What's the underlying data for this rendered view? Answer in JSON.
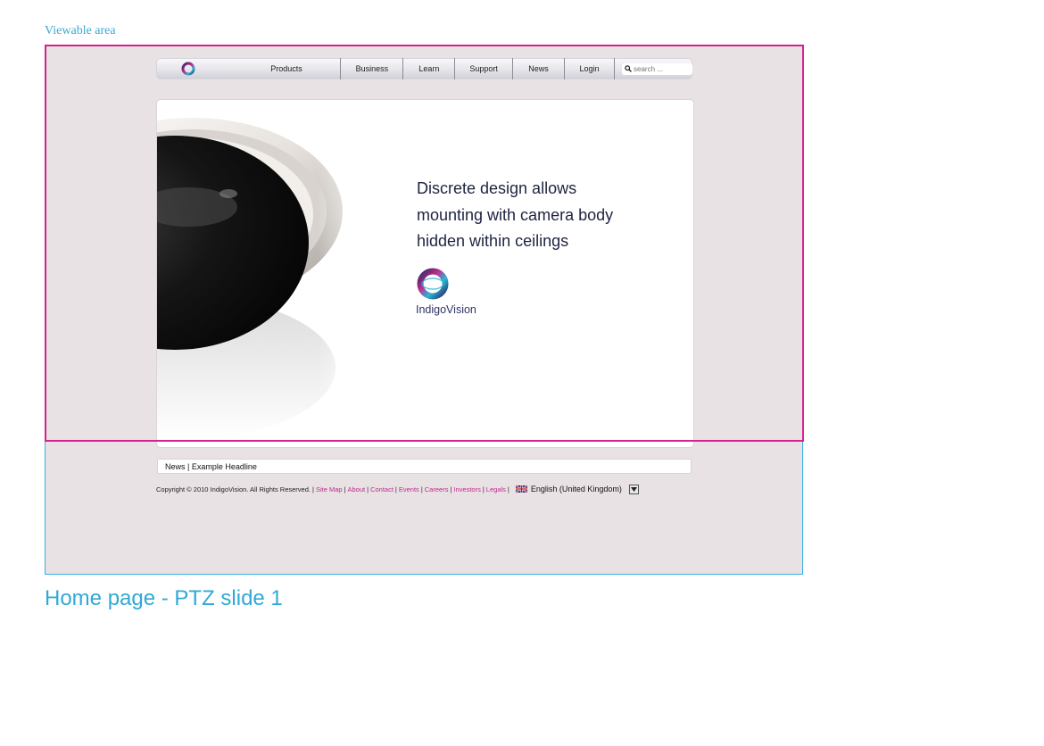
{
  "annotation": {
    "viewable_label": "Viewable area",
    "caption": "Home page - PTZ slide 1"
  },
  "nav": {
    "logo_icon": "indigovision-ring-icon",
    "items": [
      {
        "label": "Products"
      },
      {
        "label": "Business"
      },
      {
        "label": "Learn"
      },
      {
        "label": "Support"
      },
      {
        "label": "News"
      },
      {
        "label": "Login"
      }
    ],
    "search": {
      "placeholder": "search ..."
    }
  },
  "hero": {
    "line1": "Discrete design allows",
    "line2": "mounting with camera body",
    "line3": "hidden within ceilings",
    "brand_name": "IndigoVision"
  },
  "news": {
    "text": "News | Example Headline"
  },
  "footer": {
    "copyright": "Copyright © 2010 IndigoVision. All Rights Reserved.",
    "links": [
      "Site Map",
      "About",
      "Contact",
      "Events",
      "Careers",
      "Investors",
      "Legals"
    ],
    "language": "English (United Kingdom)",
    "flag_icon": "uk-flag-icon",
    "dropdown_icon": "dropdown-arrow-icon"
  },
  "colors": {
    "canvas_bg": "#e8e2e4",
    "viewable_border": "#d6228b",
    "page_border": "#35b0e2",
    "link": "#c2288c",
    "caption": "#2fa9d6"
  }
}
